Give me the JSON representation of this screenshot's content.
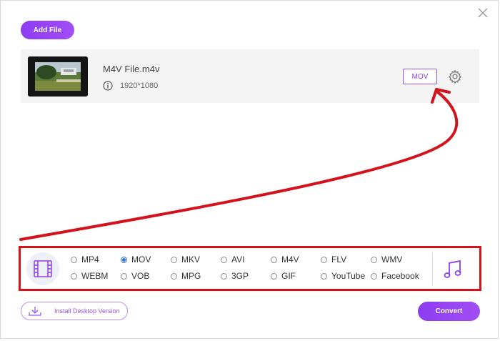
{
  "toolbar": {
    "add_file_label": "Add File"
  },
  "file": {
    "name": "M4V File.m4v",
    "resolution": "1920*1080",
    "output_format": "MOV"
  },
  "formats": {
    "row1": [
      "MP4",
      "MOV",
      "MKV",
      "AVI",
      "M4V",
      "FLV",
      "WMV"
    ],
    "row2": [
      "WEBM",
      "VOB",
      "MPG",
      "3GP",
      "GIF",
      "YouTube",
      "Facebook"
    ],
    "selected": "MOV"
  },
  "footer": {
    "install_label": "Install Desktop Version",
    "convert_label": "Convert"
  },
  "colors": {
    "accent": "#8e3cf2",
    "annotation": "#d4121c",
    "radio_selected": "#2b6cf6"
  }
}
